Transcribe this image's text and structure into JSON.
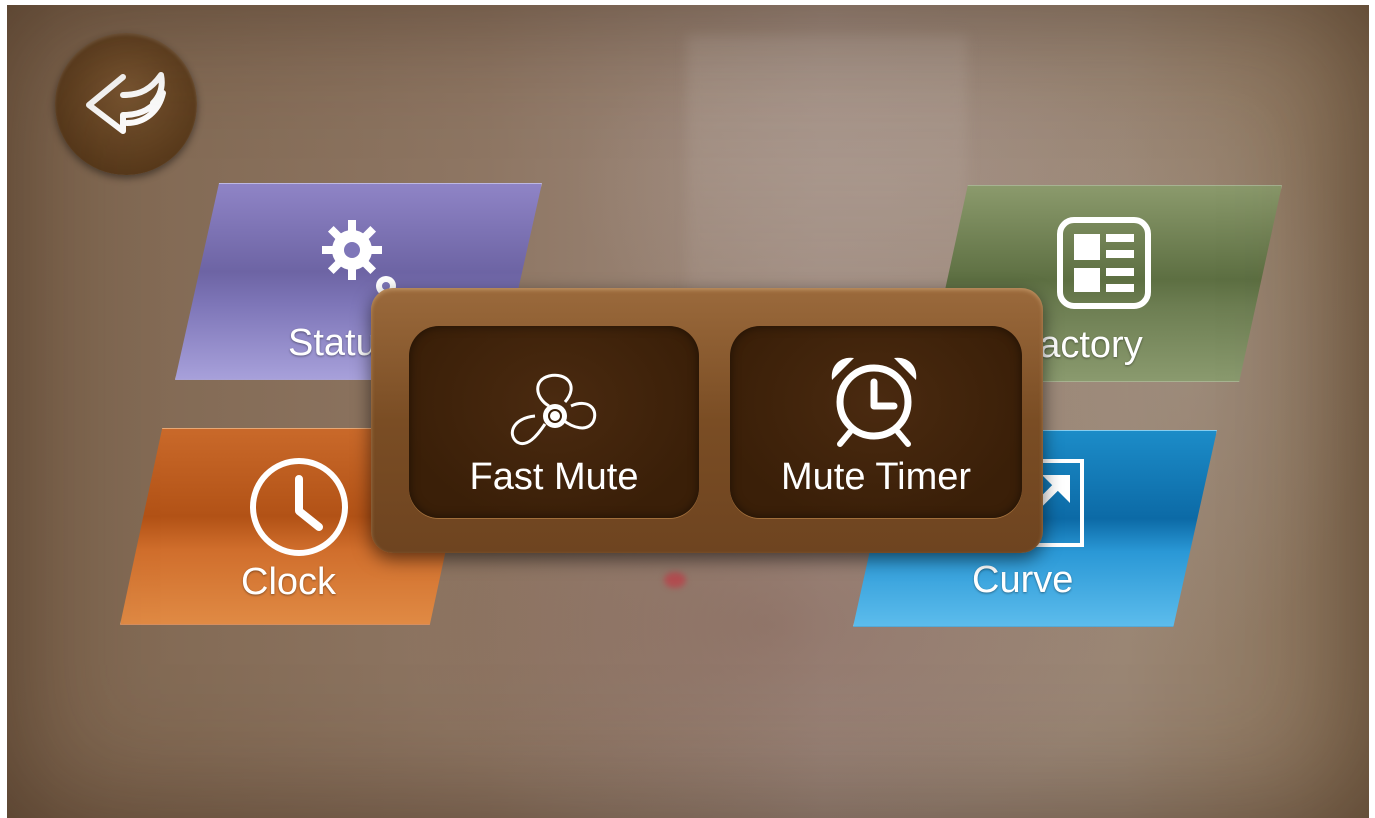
{
  "back": {
    "icon": "back-arrow-icon"
  },
  "tiles": {
    "status": {
      "label": "Status",
      "icon": "gears-icon"
    },
    "factory": {
      "label": "Factory",
      "icon": "layout-grid-icon"
    },
    "clock": {
      "label": "Clock",
      "icon": "clock-icon"
    },
    "curve": {
      "label": "Curve",
      "icon": "expand-arrow-icon"
    }
  },
  "popup": {
    "buttons": [
      {
        "label": "Fast Mute",
        "icon": "fan-icon"
      },
      {
        "label": "Mute Timer",
        "icon": "alarm-clock-icon"
      }
    ]
  },
  "colors": {
    "status": "#7e76b8",
    "factory": "#6d7e52",
    "clock": "#d06e2c",
    "curve": "#2a98d6",
    "popup": "#7a4d24"
  }
}
